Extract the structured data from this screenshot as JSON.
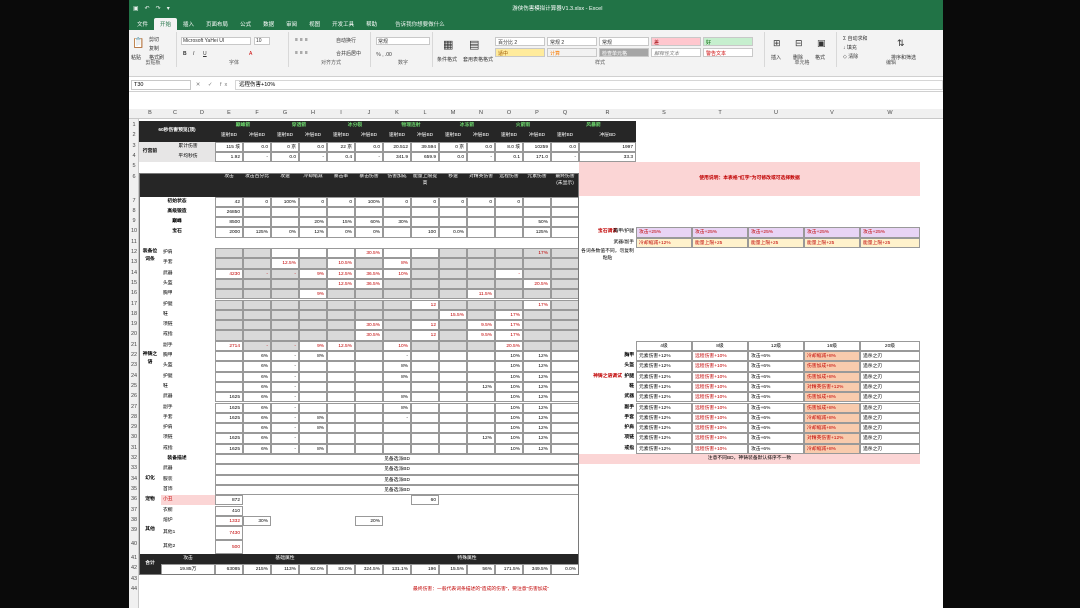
{
  "window": {
    "title": "游侠伤害模拟计算器V1.3.xlsx - Excel"
  },
  "ribbon": {
    "tabs": [
      "文件",
      "开始",
      "插入",
      "页面布局",
      "公式",
      "数据",
      "审阅",
      "视图",
      "开发工具",
      "帮助"
    ],
    "active_tab": "开始",
    "tell_me": "告诉我你想要做什么",
    "clipboard": {
      "cut": "剪切",
      "copy": "复制",
      "format_painter": "格式刷",
      "paste": "粘贴",
      "label": "剪贴板"
    },
    "font": {
      "name": "Microsoft YaHei UI",
      "size": "10",
      "label": "字体"
    },
    "alignment": {
      "wrap": "自动换行",
      "merge": "合并后居中",
      "label": "对齐方式"
    },
    "number": {
      "format": "常规",
      "label": "数字"
    },
    "styles": {
      "conditional": "条件格式",
      "table": "套用表格格式",
      "label": "样式",
      "cells": [
        "百分比 2",
        "常规 2",
        "常规",
        "差",
        "好",
        "适中",
        "计算",
        "检查单元格",
        "解释性文本",
        "警告文本"
      ]
    },
    "cells": {
      "insert": "插入",
      "delete": "删除",
      "format": "格式",
      "label": "单元格"
    },
    "editing": {
      "autosum": "自动求和",
      "fill": "填充",
      "clear": "清除",
      "sort": "排序和筛选",
      "find": "查找和选择",
      "label": "编辑"
    }
  },
  "formula_bar": {
    "name_box": "T30",
    "content": "远程伤害+10%"
  },
  "columns": [
    "B",
    "C",
    "D",
    "E",
    "F",
    "G",
    "H",
    "I",
    "J",
    "K",
    "L",
    "M",
    "N",
    "O",
    "P",
    "Q",
    "R",
    "S",
    "T",
    "U",
    "V",
    "W"
  ],
  "rows": [
    "1",
    "2",
    "3",
    "4",
    "5",
    "6",
    "7",
    "8",
    "9",
    "10",
    "11",
    "12",
    "13",
    "14",
    "15",
    "16",
    "17",
    "18",
    "19",
    "20",
    "21",
    "22",
    "23",
    "24",
    "25",
    "26",
    "27",
    "28",
    "29",
    "30",
    "31",
    "32",
    "33",
    "34",
    "35",
    "36",
    "37",
    "38",
    "39",
    "40",
    "41",
    "42",
    "43",
    "44"
  ],
  "top_table": {
    "title": "60秒伤害预览(顶)",
    "classes": [
      "巅峰箭",
      "穿透箭",
      "冰分裂",
      "物理连射",
      "冰冻箭",
      "火箭雨",
      "风暴箭"
    ],
    "sub": [
      "速射BD",
      "冲层BD",
      "速射BD",
      "冲层BD",
      "速射BD",
      "冲层BD",
      "速射BD",
      "冲层BD",
      "速射BD",
      "冲层BD",
      "速射BD",
      "冲层BD",
      "速射BD",
      "冲层BD"
    ],
    "row_label": "行宫前",
    "r1_label": "累计伤害",
    "r2_label": "平均秒伤",
    "r1": [
      "115 垓",
      "0.0",
      "0 京",
      "0.0",
      "22 京",
      "0.0",
      "20.512",
      "39.594",
      "0 京",
      "0.0",
      "8.0 垓",
      "10259",
      "0.0",
      "1997"
    ],
    "r2": [
      "1.92",
      "-",
      "0.0",
      "-",
      "0.4",
      "-",
      "341.9",
      "659.9",
      "0.0",
      "-",
      "0.1",
      "171.0",
      "-",
      "33.3"
    ]
  },
  "headers": [
    "攻击",
    "攻击百分比",
    "攻速",
    "冷却缩减",
    "暴击率",
    "暴击伤害",
    "伤害加成",
    "能量上限提高",
    "移速",
    "对精英伤害",
    "远程伤害",
    "元素伤害",
    "最终伤害(未显示)"
  ],
  "base_rows": [
    {
      "label": "初始状态",
      "v": [
        "42",
        "0",
        "100%",
        "0",
        "0",
        "100%",
        "0",
        "0",
        "0",
        "0",
        "0",
        "",
        ""
      ]
    },
    {
      "label": "高级锻造",
      "v": [
        "26850",
        "",
        "",
        "",
        "",
        "",
        "",
        "",
        "",
        "",
        "",
        "",
        ""
      ]
    },
    {
      "label": "巅峰",
      "v": [
        "8500",
        "",
        "",
        "20%",
        "15%",
        "60%",
        "30%",
        "",
        "",
        "",
        "",
        "50%",
        ""
      ]
    },
    {
      "label": "宝石",
      "v": [
        "2000",
        "125%",
        "0%",
        "12%",
        "0%",
        "0%",
        "",
        "100",
        "0.0%",
        "",
        "",
        "125%",
        ""
      ]
    }
  ],
  "equip_label": "装备位词条",
  "equip": [
    {
      "slot": "护肩",
      "v": [
        "",
        "",
        "",
        "",
        "",
        "30.5%",
        "",
        "",
        "",
        "",
        "",
        "17%",
        ""
      ]
    },
    {
      "slot": "手套",
      "v": [
        "",
        "",
        "12.5%",
        "",
        "10.5%",
        "",
        "8%",
        "",
        "",
        "",
        "",
        "",
        ""
      ]
    },
    {
      "slot": "武器",
      "v": [
        "4230",
        "-",
        "-",
        "9%",
        "12.5%",
        "36.5%",
        "10%",
        "",
        "",
        "",
        "-",
        "",
        ""
      ]
    },
    {
      "slot": "头盔",
      "v": [
        "",
        "",
        "",
        "",
        "12.5%",
        "36.5%",
        "",
        "",
        "",
        "",
        "",
        "20.5%",
        ""
      ]
    },
    {
      "slot": "胸甲",
      "v": [
        "",
        "",
        "",
        "9%",
        "",
        "",
        "",
        "",
        "",
        "11.5%",
        "",
        "",
        ""
      ]
    },
    {
      "slot": "护腿",
      "v": [
        "",
        "",
        "",
        "",
        "",
        "",
        "",
        "12",
        "",
        "",
        "",
        "17%",
        ""
      ]
    },
    {
      "slot": "鞋",
      "v": [
        "",
        "",
        "",
        "",
        "",
        "",
        "",
        "",
        "15.5%",
        "",
        "17%",
        "",
        ""
      ]
    },
    {
      "slot": "项链",
      "v": [
        "",
        "",
        "",
        "",
        "",
        "30.5%",
        "",
        "12",
        "",
        "9.5%",
        "17%",
        "",
        ""
      ]
    },
    {
      "slot": "戒指",
      "v": [
        "",
        "",
        "",
        "",
        "",
        "30.5%",
        "",
        "12",
        "",
        "9.5%",
        "17%",
        "",
        ""
      ]
    },
    {
      "slot": "副手",
      "v": [
        "2714",
        "-",
        "-",
        "9%",
        "12.5%",
        "",
        "10%",
        "",
        "",
        "",
        "20.5%",
        "",
        ""
      ]
    }
  ],
  "shenzhu_label": "神铸之语",
  "shenzhu": [
    {
      "slot": "胸甲",
      "v": [
        "",
        "6%",
        "-",
        "8%",
        "",
        "",
        "-",
        "",
        "",
        "",
        "10%",
        "12%",
        ""
      ]
    },
    {
      "slot": "头盔",
      "v": [
        "",
        "6%",
        "-",
        "",
        "",
        "",
        "8%",
        "",
        "",
        "",
        "10%",
        "12%",
        ""
      ]
    },
    {
      "slot": "护腿",
      "v": [
        "",
        "6%",
        "-",
        "",
        "",
        "",
        "8%",
        "",
        "",
        "",
        "10%",
        "12%",
        ""
      ]
    },
    {
      "slot": "鞋",
      "v": [
        "",
        "6%",
        "-",
        "",
        "",
        "",
        "",
        "",
        "",
        "12%",
        "10%",
        "12%",
        ""
      ]
    },
    {
      "slot": "武器",
      "v": [
        "1625",
        "6%",
        "-",
        "",
        "",
        "",
        "8%",
        "",
        "",
        "",
        "10%",
        "12%",
        ""
      ]
    },
    {
      "slot": "副手",
      "v": [
        "1625",
        "6%",
        "-",
        "",
        "",
        "",
        "8%",
        "",
        "",
        "",
        "10%",
        "12%",
        ""
      ]
    },
    {
      "slot": "手套",
      "v": [
        "1625",
        "6%",
        "-",
        "8%",
        "",
        "",
        "-",
        "",
        "",
        "",
        "10%",
        "12%",
        ""
      ]
    },
    {
      "slot": "护肩",
      "v": [
        "",
        "6%",
        "-",
        "8%",
        "",
        "",
        "",
        "",
        "",
        "",
        "10%",
        "12%",
        ""
      ]
    },
    {
      "slot": "项链",
      "v": [
        "1625",
        "6%",
        "-",
        "",
        "",
        "",
        "",
        "",
        "",
        "12%",
        "10%",
        "12%",
        ""
      ]
    },
    {
      "slot": "戒指",
      "v": [
        "1625",
        "6%",
        "-",
        "8%",
        "",
        "",
        "",
        "",
        "",
        "",
        "10%",
        "12%",
        ""
      ]
    }
  ],
  "desc_label": "装备描述",
  "desc_text": "见备选派BD",
  "huanshu_label": "幻化",
  "huanshu": [
    {
      "slot": "武器",
      "text": "见备选派BD"
    },
    {
      "slot": "服装",
      "text": "见备选派BD"
    },
    {
      "slot": "首饰",
      "text": "见备选派BD"
    }
  ],
  "pet_label": "宠物",
  "pet": {
    "slot": "小丑",
    "v": "872",
    "k": "60"
  },
  "other_label": "其他",
  "other": [
    {
      "slot": "衣橱",
      "v": "410"
    },
    {
      "slot": "熔炉",
      "v": "1332",
      "p": "30%",
      "x": "20%"
    },
    {
      "slot": "其他1",
      "v": "7430"
    },
    {
      "slot": "其他2",
      "v": "500"
    }
  ],
  "total": {
    "label": "合计",
    "a": "攻击",
    "b": "基础属性",
    "c": "特殊属性",
    "vals": [
      "19.85万",
      "63085",
      "215%",
      "113%",
      "62.0%",
      "83.0%",
      "324.5%",
      "131.1%",
      "196",
      "15.5%",
      "56%",
      "171.5%",
      "349.5%",
      "0.0%"
    ]
  },
  "footnote": "最终伤害：一般代表词条描述的“造成的伤害”，要注意“伤害加成”",
  "right": {
    "notice": "使用说明：本表格\"红字\"为可修改或可选择数据",
    "gem_label": "宝石调试",
    "gem_rows": [
      {
        "k": "胸甲/护腿",
        "cells": [
          "攻击+25%",
          "攻击+25%",
          "攻击+25%",
          "攻击+25%",
          "攻击+25%"
        ]
      },
      {
        "k": "武器/副手",
        "cells": [
          "冷却缩减+12%",
          "能量上限+25",
          "能量上限+25",
          "能量上限+25",
          "能量上限+25"
        ]
      }
    ],
    "vertical_note": "各词条数值不同，勿复制粘贴",
    "levels": [
      "4级",
      "8级",
      "12级",
      "16级",
      "20级"
    ],
    "sz_label": "神铸之语调试",
    "sz_rows": [
      {
        "k": "胸甲",
        "c": [
          "元素伤害+12%",
          "远程伤害+10%",
          "攻击+6%",
          "冷却缩减+8%",
          "追杀之刃"
        ]
      },
      {
        "k": "头盔",
        "c": [
          "元素伤害+12%",
          "远程伤害+10%",
          "攻击+6%",
          "伤害加成+8%",
          "追杀之刃"
        ]
      },
      {
        "k": "护腿",
        "c": [
          "元素伤害+12%",
          "远程伤害+10%",
          "攻击+6%",
          "伤害加成+8%",
          "追杀之刃"
        ]
      },
      {
        "k": "鞋",
        "c": [
          "元素伤害+12%",
          "远程伤害+10%",
          "攻击+6%",
          "对精英伤害+12%",
          "追杀之刃"
        ]
      },
      {
        "k": "武器",
        "c": [
          "元素伤害+12%",
          "远程伤害+10%",
          "攻击+6%",
          "伤害加成+8%",
          "追杀之刃"
        ]
      },
      {
        "k": "副手",
        "c": [
          "元素伤害+12%",
          "远程伤害+10%",
          "攻击+6%",
          "伤害加成+8%",
          "追杀之刃"
        ]
      },
      {
        "k": "手套",
        "c": [
          "元素伤害+12%",
          "远程伤害+10%",
          "攻击+6%",
          "冷却缩减+8%",
          "追杀之刃"
        ]
      },
      {
        "k": "护肩",
        "c": [
          "元素伤害+12%",
          "远程伤害+10%",
          "攻击+6%",
          "冷却缩减+8%",
          "追杀之刃"
        ]
      },
      {
        "k": "项链",
        "c": [
          "元素伤害+12%",
          "远程伤害+10%",
          "攻击+6%",
          "对精英伤害+12%",
          "追杀之刃"
        ]
      },
      {
        "k": "戒指",
        "c": [
          "元素伤害+12%",
          "远程伤害+10%",
          "攻击+6%",
          "冷却缩减+8%",
          "追杀之刃"
        ]
      }
    ],
    "sz_note": "注意不同BD，神铸装备默认排序不一致"
  }
}
